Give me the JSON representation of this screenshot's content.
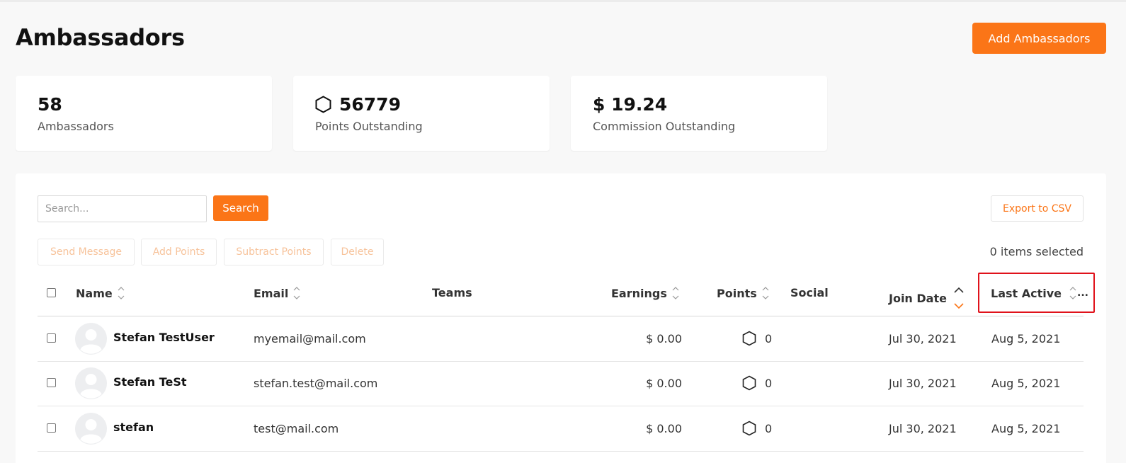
{
  "header": {
    "title": "Ambassadors",
    "add_button_label": "Add Ambassadors"
  },
  "stats": [
    {
      "value": "58",
      "label": "Ambassadors",
      "icon": ""
    },
    {
      "value": "56779",
      "label": "Points Outstanding",
      "icon": "hexagon-icon"
    },
    {
      "value": "$ 19.24",
      "label": "Commission Outstanding",
      "icon": ""
    }
  ],
  "toolbar": {
    "search_placeholder": "Search...",
    "search_value": "",
    "search_button": "Search",
    "export_button": "Export to CSV",
    "actions": [
      "Send Message",
      "Add Points",
      "Subtract Points",
      "Delete"
    ],
    "selected_count": "0 items selected"
  },
  "table": {
    "columns": [
      "Name",
      "Email",
      "Teams",
      "Earnings",
      "Points",
      "Social",
      "Join Date",
      "Last Active"
    ],
    "rows": [
      {
        "name": "Stefan TestUser",
        "email": "myemail@mail.com",
        "teams": "",
        "earnings": "$ 0.00",
        "points": "0",
        "social": "",
        "join_date": "Jul 30, 2021",
        "last_active": "Aug 5, 2021"
      },
      {
        "name": "Stefan TeSt",
        "email": "stefan.test@mail.com",
        "teams": "",
        "earnings": "$ 0.00",
        "points": "0",
        "social": "",
        "join_date": "Jul 30, 2021",
        "last_active": "Aug 5, 2021"
      },
      {
        "name": "stefan",
        "email": "test@mail.com",
        "teams": "",
        "earnings": "$ 0.00",
        "points": "0",
        "social": "",
        "join_date": "Jul 30, 2021",
        "last_active": "Aug 5, 2021"
      }
    ],
    "overflow_indicator": "..."
  },
  "colors": {
    "accent": "#fb7517",
    "accent_faded": "#f7c39b",
    "highlight": "#e0121b"
  }
}
